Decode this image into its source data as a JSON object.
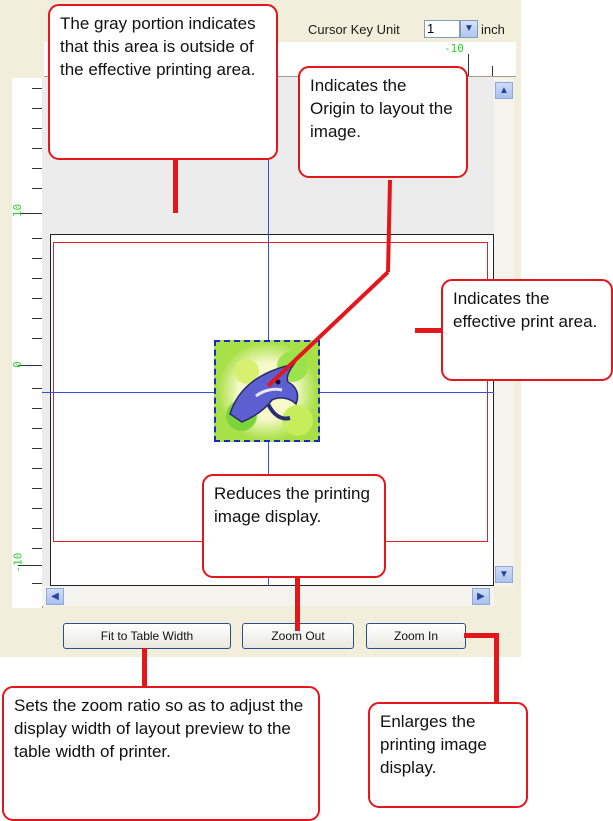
{
  "toolbar": {
    "cursor_key_unit_label": "Cursor Key Unit",
    "unit_value": "1",
    "unit_suffix": "inch"
  },
  "rulers": {
    "top_numbers": [
      "-10"
    ],
    "left_numbers": [
      "10",
      "0",
      "-10"
    ]
  },
  "buttons": {
    "fit_to_table_width": "Fit to Table Width",
    "zoom_out": "Zoom Out",
    "zoom_in": "Zoom In"
  },
  "scrollbar_glyphs": {
    "up": "▲",
    "down": "▼",
    "left": "◀",
    "right": "▶",
    "dropdown": "▼"
  },
  "callouts": {
    "gray_portion": "The gray portion indicates that this area is outside of the effective printing area.",
    "origin": "Indicates the Origin to layout the image.",
    "effective_area": "Indicates the effective print area.",
    "reduce": "Reduces the printing image display.",
    "fit_width": "Sets the zoom ratio so as to adjust the display width of layout preview to the table width of printer.",
    "enlarge": "Enlarges the printing image display."
  },
  "colors": {
    "callout_border": "#e3161b",
    "guide_line": "#3a4fd8",
    "print_area": "#e0202a",
    "ruler_numbers": "#2fd12f",
    "outside_area": "#ececec"
  }
}
